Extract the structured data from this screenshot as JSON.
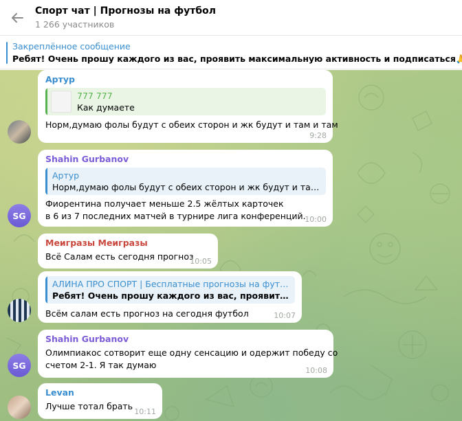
{
  "header": {
    "title": "Спорт чат | Прогнозы на футбол",
    "subtitle": "1 266 участников"
  },
  "pinned": {
    "label": "Закреплённое сообщение",
    "text": "Ребят! Очень прошу каждого из вас, проявить максимальную активность и подписаться",
    "emoji": "🙏"
  },
  "messages": [
    {
      "sender": "Артур",
      "sender_color": "#3a8ed0",
      "reply": {
        "name": "777 777",
        "text": "Как думаете",
        "name_color": "#56b24c"
      },
      "text": "Норм,думаю фолы будут с обеих сторон и жк будут и там и там",
      "time": "9:28"
    },
    {
      "sender": "Shahin Gurbanov",
      "sender_color": "#7b5bd6",
      "avatar_initials": "SG",
      "reply": {
        "name": "Артур",
        "text": "Норм,думаю фолы будут с обеих сторон и жк будут и там и т...",
        "name_color": "#3a8ed0"
      },
      "text_lines": [
        "Фиорентина получает меньше 2.5 жёлтых карточек",
        "в 6 из 7 последних матчей в турнире лига конференций."
      ],
      "time": "10:00"
    },
    {
      "sender": "Меигразы Меигразы",
      "sender_color": "#c9473c",
      "text": "Всё Салам есть сегодня прогноз",
      "time": "10:05"
    },
    {
      "reply": {
        "name": "АЛИНА ПРО СПОРТ | Бесплатные прогнозы на футбол",
        "text": "Ребят! Очень прошу каждого из вас, проявить макс...",
        "name_color": "#3a8ed0"
      },
      "text": "Всём салам есть прогноз на сегодня футбол",
      "time": "10:07"
    },
    {
      "sender": "Shahin Gurbanov",
      "sender_color": "#7b5bd6",
      "avatar_initials": "SG",
      "text_lines": [
        "Олимпиакос сотворит еще одну сенсацию и одержит победу со",
        "счетом 2-1. Я так думаю"
      ],
      "time": "10:08"
    },
    {
      "sender": "Levan",
      "sender_color": "#3a8ed0",
      "text": "Лучше тотал брать",
      "time": "10:11"
    }
  ]
}
